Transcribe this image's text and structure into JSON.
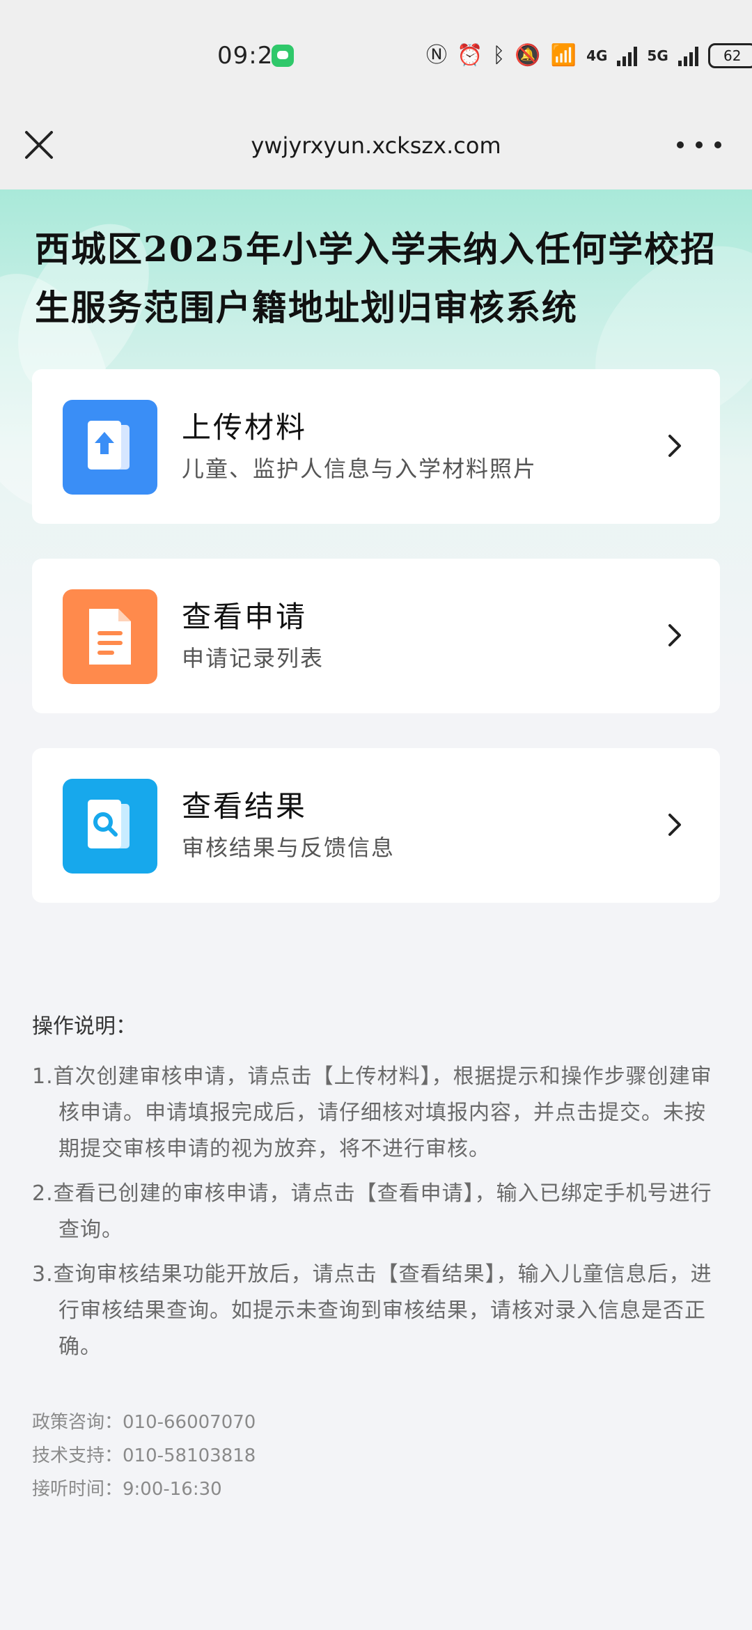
{
  "status_bar": {
    "time": "09:21",
    "battery": "62",
    "net1": "4G",
    "net2": "5G"
  },
  "browser": {
    "url": "ywjyrxyun.xckszx.com"
  },
  "page": {
    "title": "西城区2025年小学入学未纳入任何学校招生服务范围户籍地址划归审核系统"
  },
  "cards": [
    {
      "title": "上传材料",
      "subtitle": "儿童、监护人信息与入学材料照片",
      "color": "#3a8ef6",
      "icon": "upload-doc-icon"
    },
    {
      "title": "查看申请",
      "subtitle": "申请记录列表",
      "color": "#ff8a4c",
      "icon": "document-icon"
    },
    {
      "title": "查看结果",
      "subtitle": "审核结果与反馈信息",
      "color": "#17a8ec",
      "icon": "search-doc-icon"
    }
  ],
  "instructions": {
    "heading": "操作说明：",
    "items": [
      "1.首次创建审核申请，请点击【上传材料】，根据提示和操作步骤创建审核申请。申请填报完成后，请仔细核对填报内容，并点击提交。未按期提交审核申请的视为放弃，将不进行审核。",
      "2.查看已创建的审核申请，请点击【查看申请】，输入已绑定手机号进行查询。",
      "3.查询审核结果功能开放后，请点击【查看结果】，输入儿童信息后，进行审核结果查询。如提示未查询到审核结果，请核对录入信息是否正确。"
    ]
  },
  "contact": {
    "policy": "政策咨询：010-66007070",
    "tech": "技术支持：010-58103818",
    "hours": "接听时间：9:00-16:30"
  }
}
